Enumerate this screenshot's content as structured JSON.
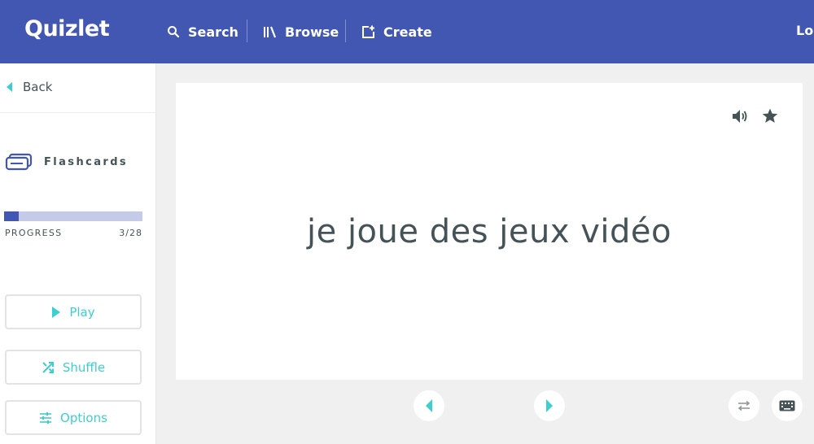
{
  "header": {
    "logo": "Quizlet",
    "nav": {
      "search_label": "Search",
      "browse_label": "Browse",
      "create_label": "Create"
    },
    "login_label": "Log"
  },
  "sidebar": {
    "back_label": "Back",
    "mode_label": "Flashcards",
    "progress": {
      "label": "PROGRESS",
      "count": "3/28",
      "current": 3,
      "total": 28
    },
    "buttons": {
      "play_label": "Play",
      "shuffle_label": "Shuffle",
      "options_label": "Options"
    }
  },
  "card": {
    "term": "je joue des jeux vidéo",
    "icons": [
      "speaker-icon",
      "star-icon"
    ]
  },
  "controls": {
    "icons": [
      "prev-arrow-icon",
      "next-arrow-icon",
      "swap-icon",
      "keyboard-icon"
    ]
  },
  "colors": {
    "brand": "#4257b2",
    "accent": "#3ccfcf",
    "progress_track": "#c5cae9",
    "text": "#455358"
  }
}
